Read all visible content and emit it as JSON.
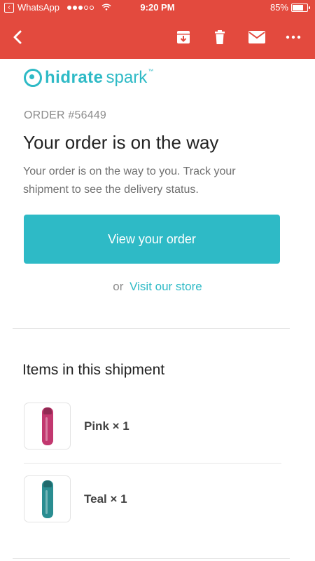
{
  "status_bar": {
    "app": "WhatsApp",
    "time": "9:20 PM",
    "battery": "85%",
    "battery_level": 0.85
  },
  "toolbar": {
    "icons": [
      "back-icon",
      "archive-icon",
      "trash-icon",
      "mail-icon",
      "more-icon"
    ],
    "accent": "#e34a3e"
  },
  "brand": {
    "name_strong": "hidrate",
    "name_light": "spark",
    "tm": "™",
    "accent": "#2ebac6"
  },
  "order": {
    "number": "ORDER #56449",
    "headline": "Your order is on the way",
    "description": "Your order is on the way to you. Track your shipment to see the delivery status.",
    "cta_label": "View your order",
    "store_prefix": "or",
    "store_link": "Visit our store"
  },
  "shipment": {
    "title": "Items in this shipment",
    "items": [
      {
        "label": "Pink × 1",
        "color": "#c2386f"
      },
      {
        "label": "Teal × 1",
        "color": "#2a8d91"
      }
    ]
  }
}
